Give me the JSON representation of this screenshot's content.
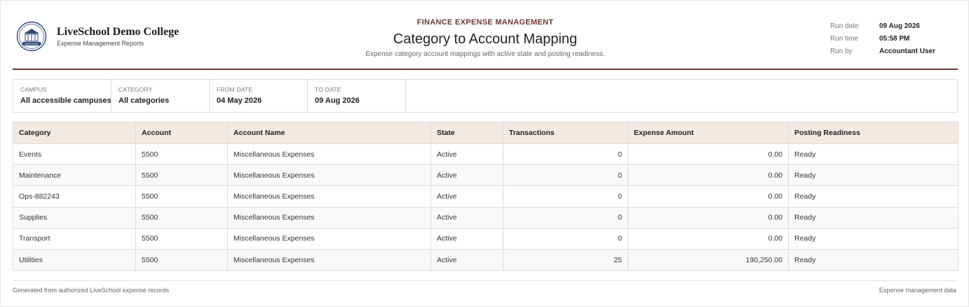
{
  "brand": {
    "name": "LiveSchool Demo College",
    "subtitle": "Expense Management Reports",
    "logo_text": "LIVESCHOOL",
    "accent_color": "#6b3a2f",
    "logo_color": "#2f4b78"
  },
  "report": {
    "eyebrow": "FINANCE EXPENSE MANAGEMENT",
    "title": "Category to Account Mapping",
    "description": "Expense category account mappings with active state and posting readiness."
  },
  "run_info": [
    {
      "label": "Run date",
      "value": "09 Aug 2026"
    },
    {
      "label": "Run time",
      "value": "05:58 PM"
    },
    {
      "label": "Run by",
      "value": "Accountant User"
    }
  ],
  "filters": [
    {
      "label": "CAMPUS",
      "value": "All accessible campuses"
    },
    {
      "label": "CATEGORY",
      "value": "All categories"
    },
    {
      "label": "FROM DATE",
      "value": "04 May 2026"
    },
    {
      "label": "TO DATE",
      "value": "09 Aug 2026"
    }
  ],
  "table": {
    "columns": [
      "Category",
      "Account",
      "Account Name",
      "State",
      "Transactions",
      "Expense Amount",
      "Posting Readiness"
    ],
    "rows": [
      [
        "Events",
        "5500",
        "Miscellaneous Expenses",
        "Active",
        "0",
        "0.00",
        "Ready"
      ],
      [
        "Maintenance",
        "5500",
        "Miscellaneous Expenses",
        "Active",
        "0",
        "0.00",
        "Ready"
      ],
      [
        "Ops-882243",
        "5500",
        "Miscellaneous Expenses",
        "Active",
        "0",
        "0.00",
        "Ready"
      ],
      [
        "Supplies",
        "5500",
        "Miscellaneous Expenses",
        "Active",
        "0",
        "0.00",
        "Ready"
      ],
      [
        "Transport",
        "5500",
        "Miscellaneous Expenses",
        "Active",
        "0",
        "0.00",
        "Ready"
      ],
      [
        "Utilities",
        "5500",
        "Miscellaneous Expenses",
        "Active",
        "25",
        "190,250.00",
        "Ready"
      ]
    ]
  },
  "footer": {
    "left": "Generated from authorized LiveSchool expense records",
    "right": "Expense management data"
  }
}
